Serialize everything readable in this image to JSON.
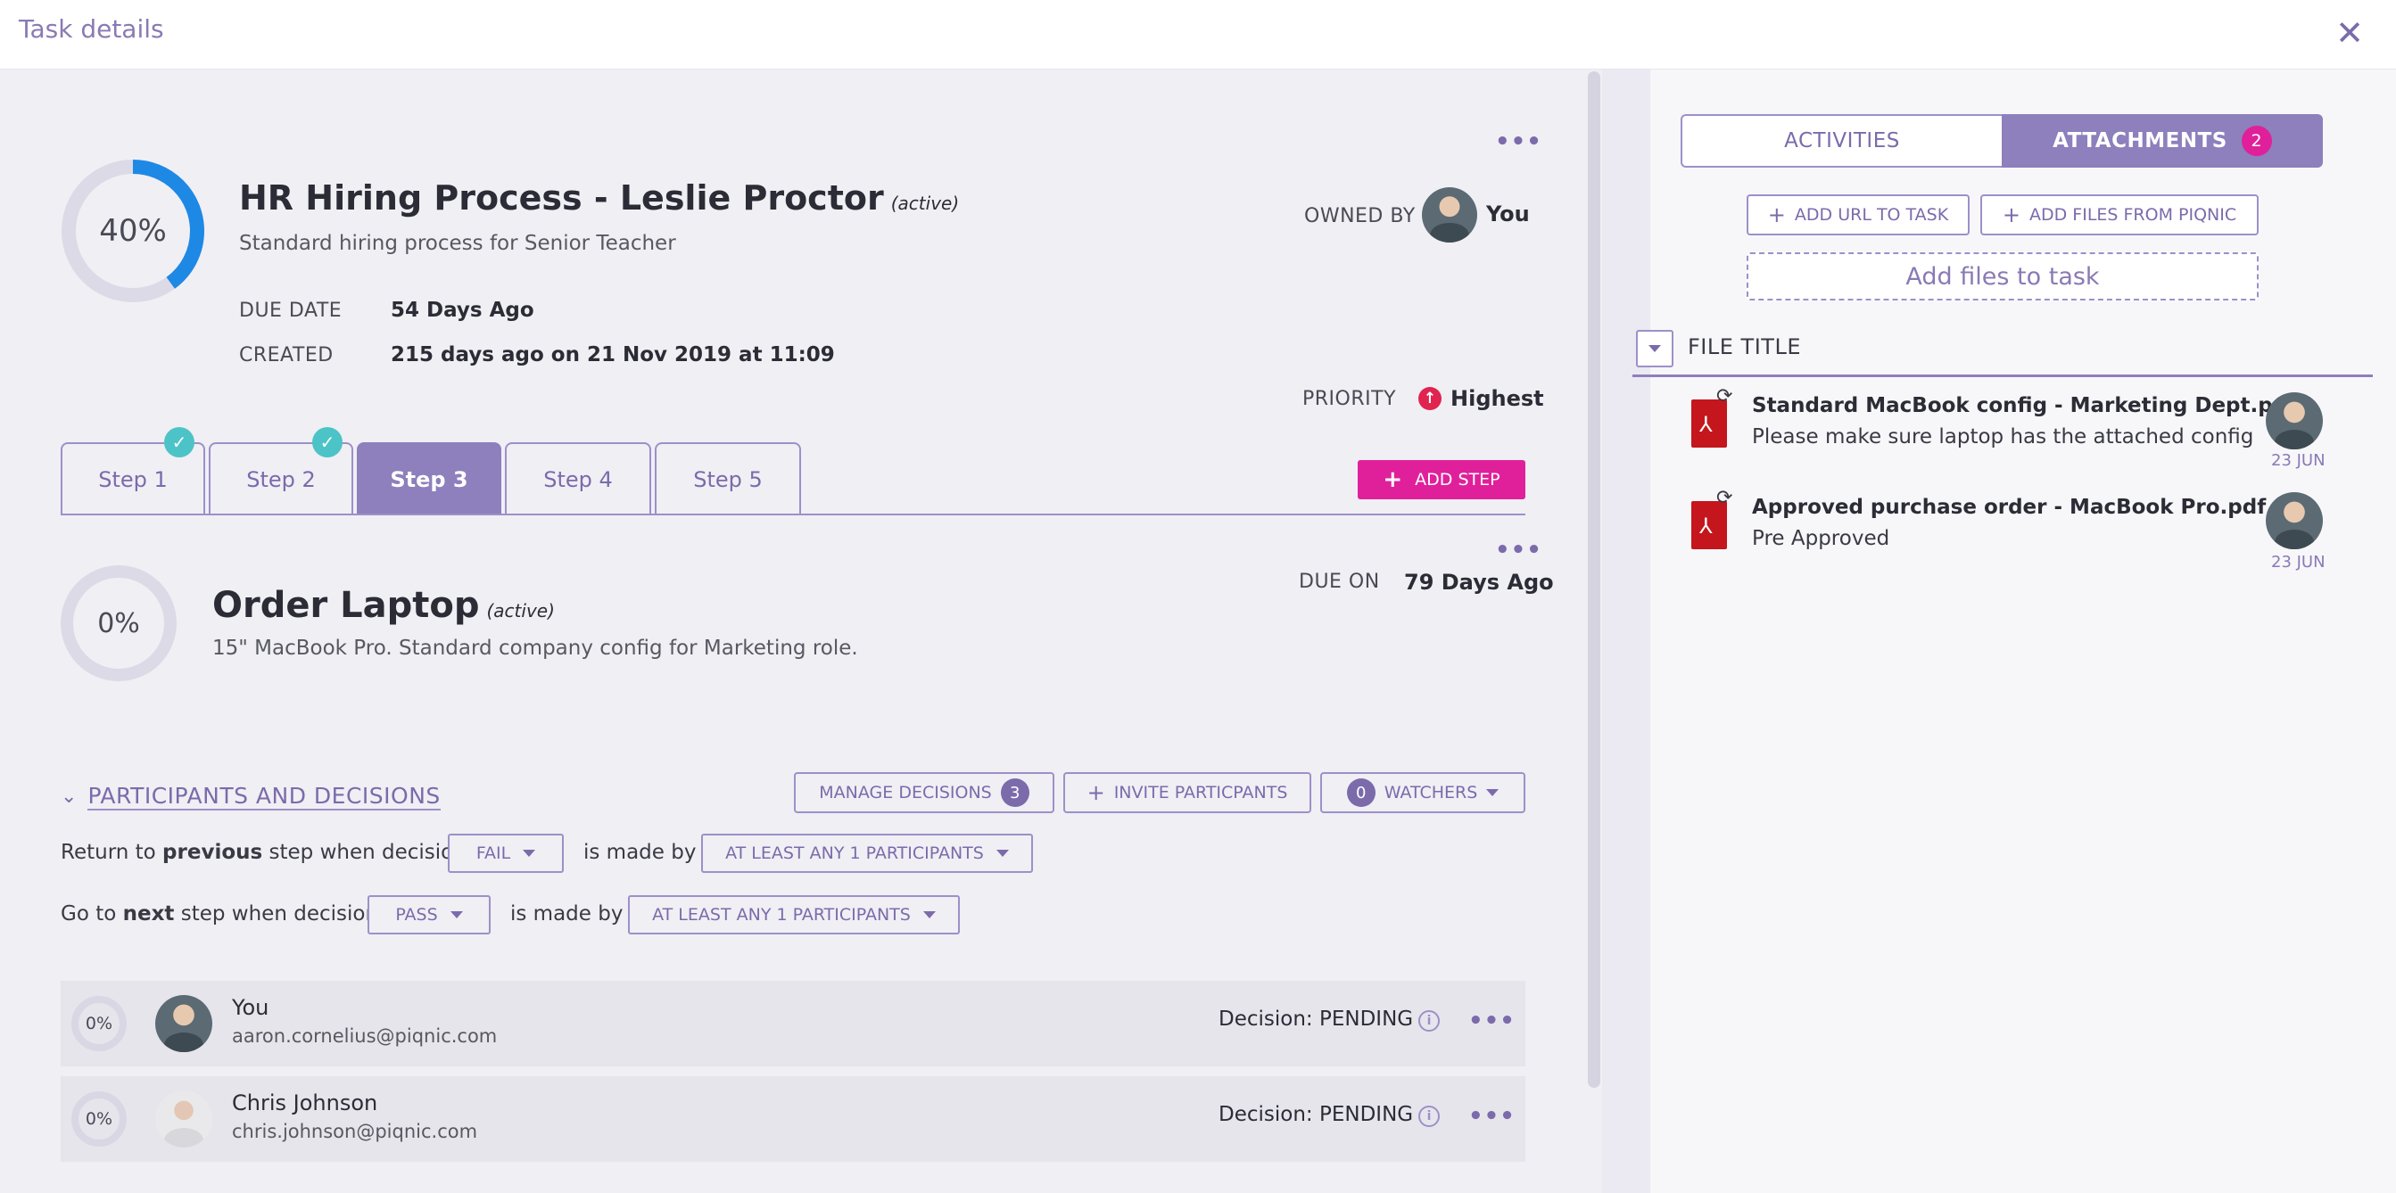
{
  "header": {
    "title": "Task details",
    "close": "✕"
  },
  "task": {
    "progress": "40%",
    "progress_value": 0.4,
    "title": "HR Hiring Process - Leslie Proctor",
    "state": "(active)",
    "subtitle": "Standard hiring process for Senior Teacher",
    "due_label": "DUE DATE",
    "due_value": "54 Days Ago",
    "created_label": "CREATED",
    "created_value": "215 days ago on 21 Nov 2019 at 11:09",
    "owned_label": "OWNED BY",
    "owner": "You",
    "priority_label": "PRIORITY",
    "priority_value": "Highest",
    "menu": "•••"
  },
  "steps": {
    "tabs": [
      {
        "label": "Step 1",
        "done": true
      },
      {
        "label": "Step 2",
        "done": true
      },
      {
        "label": "Step 3",
        "active": true
      },
      {
        "label": "Step 4"
      },
      {
        "label": "Step 5"
      }
    ],
    "add_label": "ADD STEP"
  },
  "step": {
    "progress": "0%",
    "title": "Order Laptop",
    "state": "(active)",
    "description": "15\" MacBook Pro. Standard company config for Marketing role.",
    "due_label": "DUE ON",
    "due_value": "79 Days Ago",
    "menu": "•••"
  },
  "participants": {
    "section_title": "PARTICIPANTS AND DECISIONS",
    "manage_label": "MANAGE DECISIONS",
    "manage_count": "3",
    "invite_label": "INVITE PARTICPANTS",
    "watchers_count": "0",
    "watchers_label": "WATCHERS",
    "rule1": {
      "prefix": "Return to ",
      "bold": "previous",
      "suffix": " step when decision",
      "decision": "FAIL",
      "madeby": "is made by",
      "quorum": "AT LEAST ANY 1 PARTICIPANTS"
    },
    "rule2": {
      "prefix": "Go to ",
      "bold": "next",
      "suffix": " step when decision",
      "decision": "PASS",
      "madeby": "is made by",
      "quorum": "AT LEAST ANY 1 PARTICIPANTS"
    },
    "rows": [
      {
        "progress": "0%",
        "name": "You",
        "email": "aaron.cornelius@piqnic.com",
        "decision": "Decision: PENDING"
      },
      {
        "progress": "0%",
        "name": "Chris Johnson",
        "email": "chris.johnson@piqnic.com",
        "decision": "Decision: PENDING"
      }
    ]
  },
  "right": {
    "tab_activities": "ACTIVITIES",
    "tab_attachments": "ATTACHMENTS",
    "attachments_count": "2",
    "add_url": "ADD URL TO TASK",
    "add_files": "ADD FILES FROM PIQNIC",
    "drop_zone": "Add files to task",
    "file_title_header": "FILE TITLE",
    "files": [
      {
        "title": "Standard MacBook config - Marketing Dept.pdf",
        "desc": "Please make sure laptop has the attached config",
        "date": "23 JUN"
      },
      {
        "title": "Approved purchase order - MacBook Pro.pdf",
        "desc": "Pre Approved",
        "date": "23 JUN"
      }
    ]
  },
  "colors": {
    "accent": "#8e7fbd",
    "pink": "#e0209a",
    "progress": "#1e88e5",
    "check": "#4cc3c7",
    "pdf": "#c4161c"
  }
}
